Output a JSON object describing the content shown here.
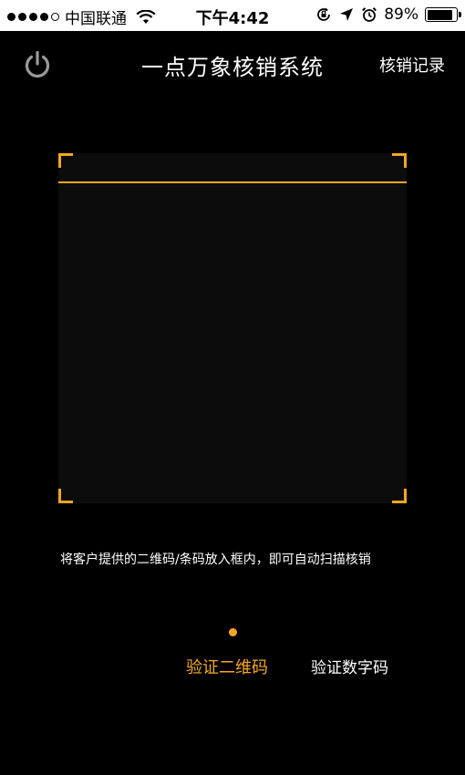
{
  "status_bar": {
    "carrier": "中国联通",
    "time": "下午4:42",
    "battery": "89%",
    "battery_level": 0.89
  },
  "nav": {
    "title": "一点万象核销系统",
    "right_link": "核销记录",
    "left_icon": "power-icon"
  },
  "scanner": {
    "hint": "将客户提供的二维码/条码放入框内，即可自动扫描核销"
  },
  "modes": {
    "qr": "验证二维码",
    "numeric": "验证数字码",
    "active": "qr"
  },
  "colors": {
    "accent": "#f5a623",
    "background": "#000000"
  }
}
